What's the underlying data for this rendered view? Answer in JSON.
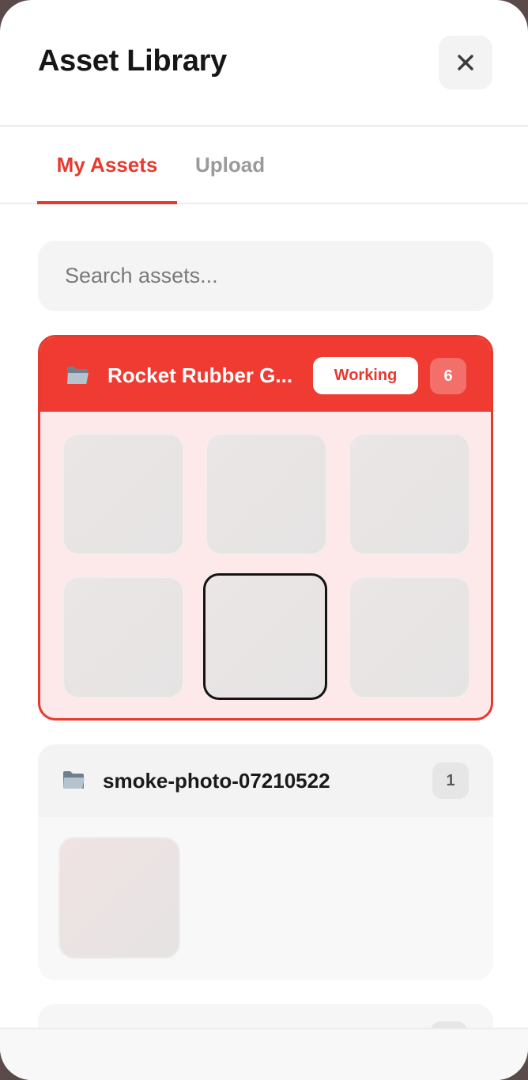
{
  "header": {
    "title": "Asset Library",
    "close_icon": "close-icon"
  },
  "tabs": [
    {
      "label": "My Assets",
      "active": true
    },
    {
      "label": "Upload",
      "active": false
    }
  ],
  "search": {
    "placeholder": "Search assets...",
    "value": ""
  },
  "folders": [
    {
      "name": "Rocket Rubber G...",
      "icon": "folder-icon",
      "status": "Working",
      "count": "6",
      "selected_thumbnail": 5
    },
    {
      "name": "smoke-photo-07210522",
      "icon": "folder-icon",
      "count": "1"
    }
  ],
  "colors": {
    "accent": "#e8392f",
    "accent_light": "#fde9e9"
  }
}
